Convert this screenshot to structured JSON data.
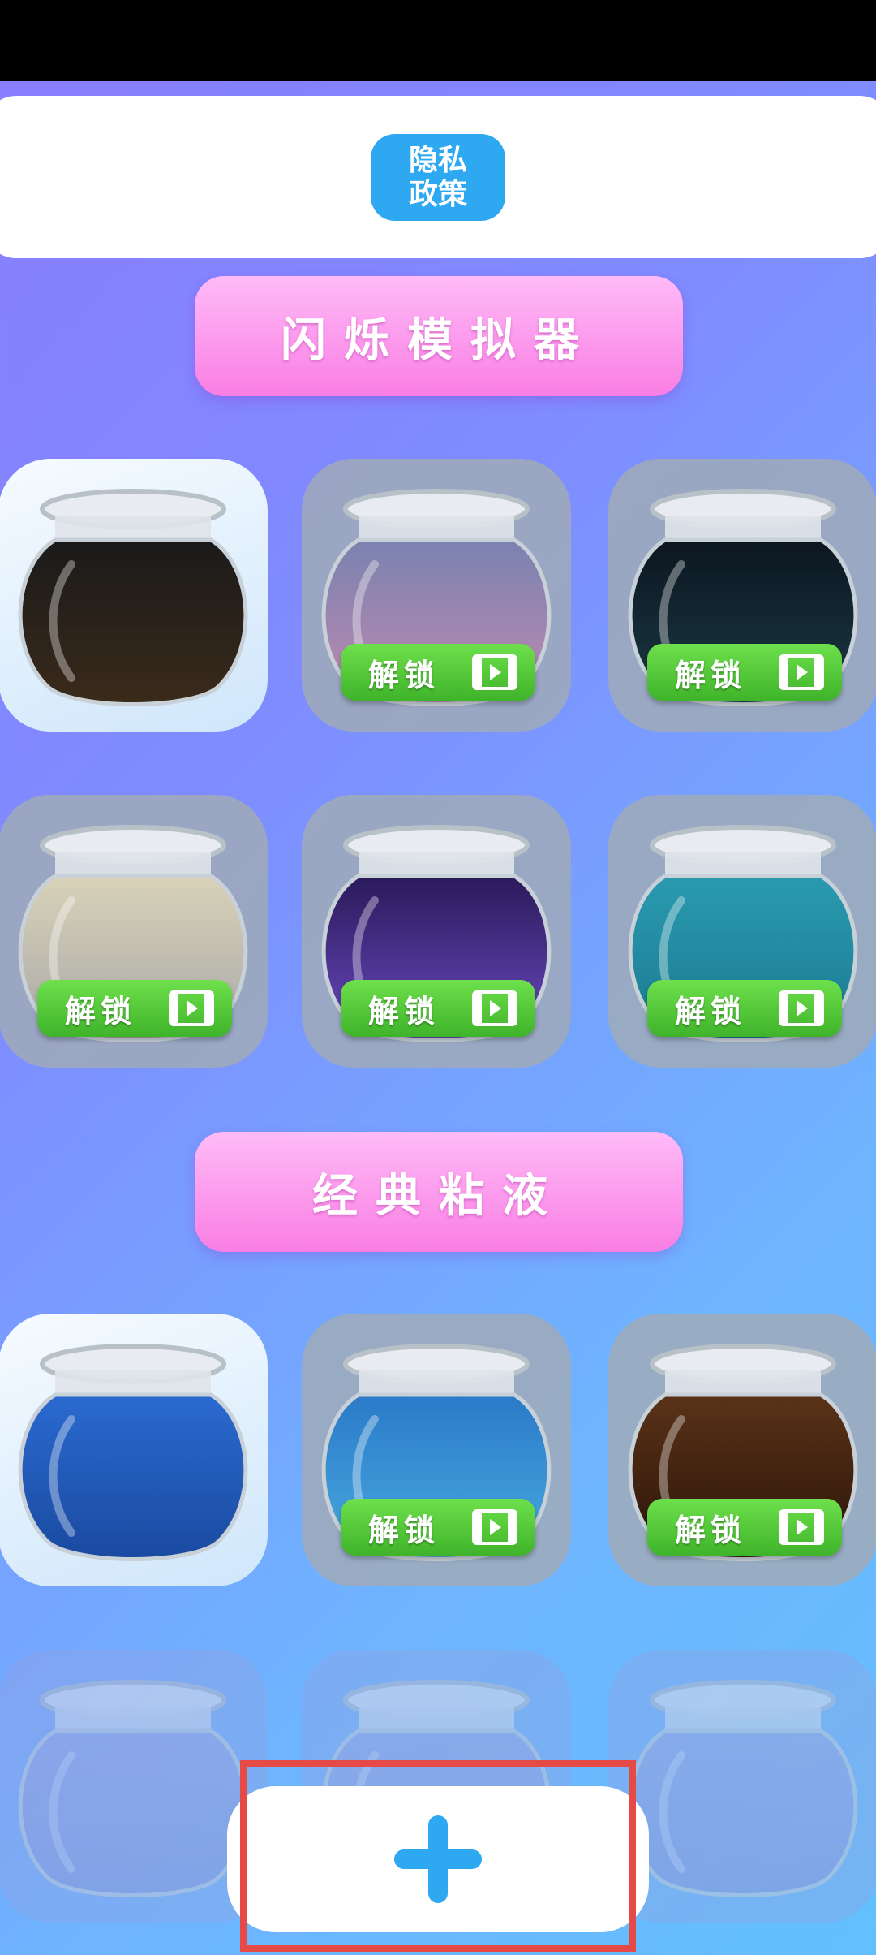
{
  "header": {
    "privacy_button_label": "隐私\n政策"
  },
  "sections": [
    {
      "title": "闪烁模拟器"
    },
    {
      "title": "经典粘液"
    }
  ],
  "unlock_label": "解锁",
  "icons": {
    "video": "video-icon",
    "add": "plus-icon"
  },
  "colors": {
    "accent_blue": "#2ea8f0",
    "unlock_green": "#4cc434",
    "section_pink": "#f98fe8",
    "highlight_red": "#e64a46"
  },
  "glitter_tiles": [
    {
      "name": "face-jar",
      "locked": false
    },
    {
      "name": "rainbow-glitter-jar",
      "locked": true
    },
    {
      "name": "star-jar",
      "locked": true
    },
    {
      "name": "marble-jar",
      "locked": true
    },
    {
      "name": "purple-galaxy-jar",
      "locked": true
    },
    {
      "name": "teal-glitter-jar",
      "locked": true
    }
  ],
  "slime_tiles": [
    {
      "name": "blue-slime-jar",
      "locked": false
    },
    {
      "name": "ocean-slime-jar",
      "locked": true
    },
    {
      "name": "brown-slime-jar",
      "locked": true
    },
    {
      "name": "faded-jar-1",
      "locked": false
    },
    {
      "name": "faded-jar-2",
      "locked": false
    },
    {
      "name": "faded-jar-3",
      "locked": false
    }
  ]
}
